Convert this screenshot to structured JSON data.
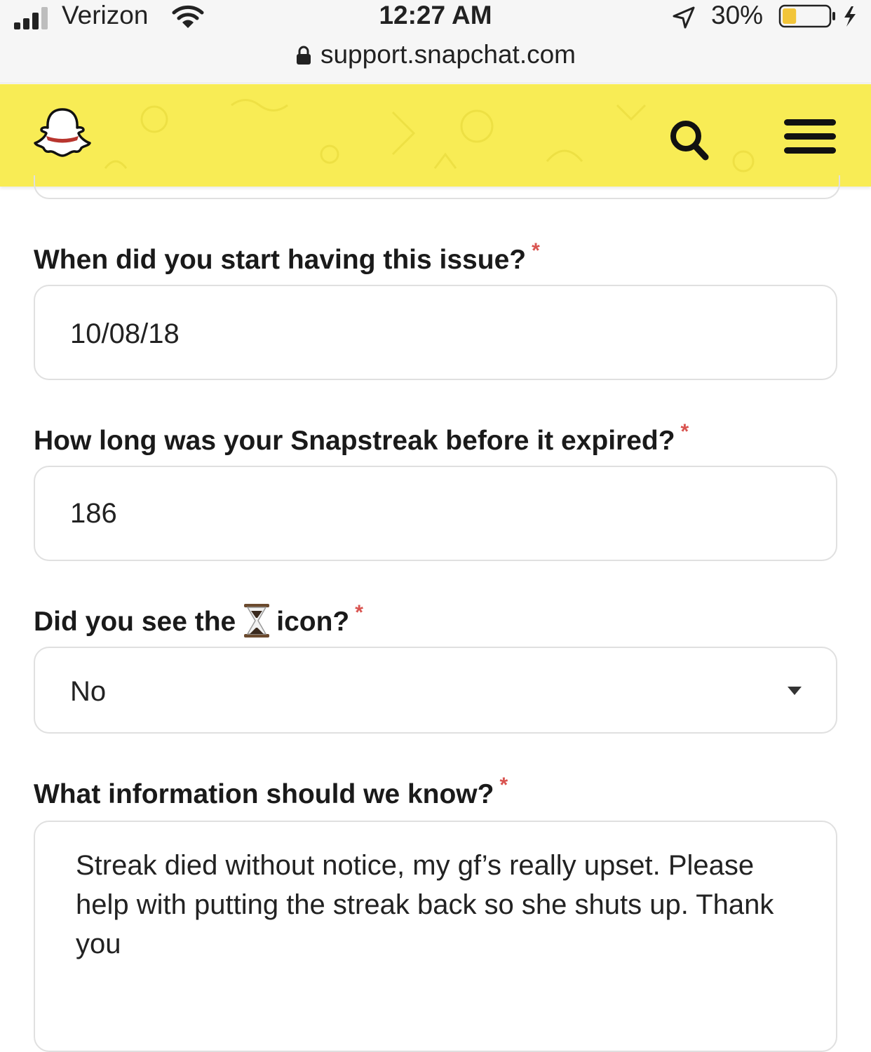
{
  "status_bar": {
    "carrier": "Verizon",
    "time": "12:27 AM",
    "battery_percent": "30%",
    "battery_level": 0.3,
    "url": "support.snapchat.com"
  },
  "header": {
    "logo_icon": "snapchat-ghost-icon",
    "search_icon": "search-icon",
    "menu_icon": "hamburger-menu-icon",
    "accent_color": "#f8ec55"
  },
  "form": {
    "q1": {
      "label": "When did you start having this issue?",
      "required": "*",
      "value": "10/08/18"
    },
    "q2": {
      "label": "How long was your Snapstreak before it expired?",
      "required": "*",
      "value": "186"
    },
    "q3": {
      "label_before": "Did you see the",
      "label_after": "icon?",
      "icon": "hourglass-icon",
      "required": "*",
      "selected": "No"
    },
    "q4": {
      "label": "What information should we know?",
      "required": "*",
      "value": "Streak died without notice, my gf’s really upset. Please help with putting the streak back so she shuts up. Thank you"
    },
    "required_color": "#d9534f"
  }
}
